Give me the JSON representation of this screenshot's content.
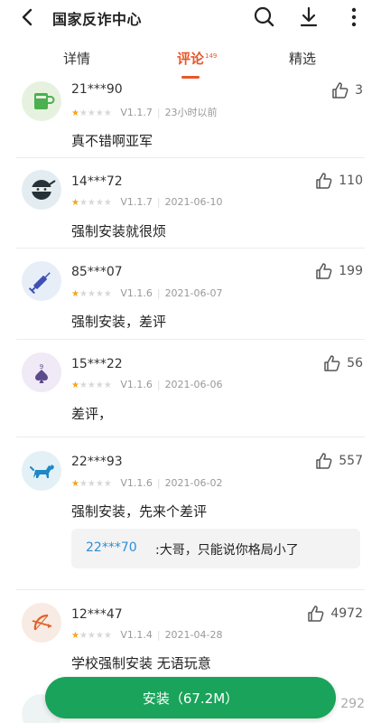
{
  "header": {
    "title": "国家反诈中心",
    "icons": [
      "back-arrow-icon",
      "search-icon",
      "download-icon",
      "more-vertical-icon"
    ]
  },
  "tabs": [
    {
      "label": "详情"
    },
    {
      "label": "评论",
      "count": "149",
      "active": true
    },
    {
      "label": "精选"
    }
  ],
  "colors": {
    "accent": "#e8562a",
    "install": "#1aa35a",
    "star": "#f2a51a",
    "reply_user": "#2a8fd6"
  },
  "reviews": [
    {
      "user": "21***90",
      "stars": 1,
      "version": "V1.1.7",
      "date": "23小时以前",
      "likes": "3",
      "text": "真不错啊亚军",
      "avatar": "cup-icon"
    },
    {
      "user": "14***72",
      "stars": 1,
      "version": "V1.1.7",
      "date": "2021-06-10",
      "likes": "110",
      "text": "强制安装就很烦",
      "avatar": "ninja-icon"
    },
    {
      "user": "85***07",
      "stars": 1,
      "version": "V1.1.6",
      "date": "2021-06-07",
      "likes": "199",
      "text": "强制安装，差评",
      "avatar": "syringe-icon"
    },
    {
      "user": "15***22",
      "stars": 1,
      "version": "V1.1.6",
      "date": "2021-06-06",
      "likes": "56",
      "text": "差评，",
      "avatar": "spade-card-icon"
    },
    {
      "user": "22***93",
      "stars": 1,
      "version": "V1.1.6",
      "date": "2021-06-02",
      "likes": "557",
      "text": "强制安装，先来个差评",
      "avatar": "dog-icon",
      "reply": {
        "user": "22***70",
        "text": ":大哥，只能说你格局小了"
      }
    },
    {
      "user": "12***47",
      "stars": 1,
      "version": "V1.1.4",
      "date": "2021-04-28",
      "likes": "4972",
      "text": "学校强制安装 无语玩意",
      "avatar": "archer-icon"
    }
  ],
  "peek": {
    "likes": "292"
  },
  "install": {
    "label": "安装（67.2M）"
  }
}
